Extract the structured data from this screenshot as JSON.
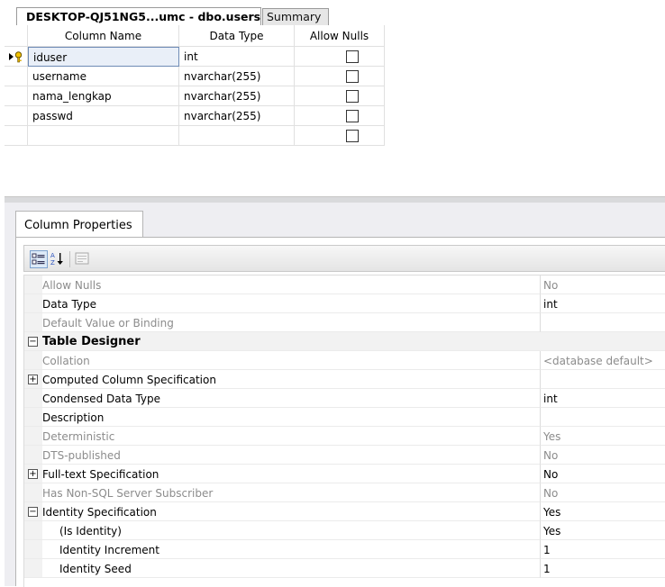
{
  "tabs": {
    "active_label": "DESKTOP-QJ51NG5...umc - dbo.users",
    "inactive_label": "Summary"
  },
  "grid": {
    "headers": [
      "Column Name",
      "Data Type",
      "Allow Nulls"
    ],
    "rows": [
      {
        "name": "iduser",
        "type": "int",
        "allow_nulls": false
      },
      {
        "name": "username",
        "type": "nvarchar(255)",
        "allow_nulls": false
      },
      {
        "name": "nama_lengkap",
        "type": "nvarchar(255)",
        "allow_nulls": false
      },
      {
        "name": "passwd",
        "type": "nvarchar(255)",
        "allow_nulls": false
      },
      {
        "name": "",
        "type": "",
        "allow_nulls": false
      }
    ]
  },
  "properties": {
    "tab_label": "Column Properties",
    "toolbar": {
      "categorized_icon": "categorized-icon",
      "alphabetical_icon": "alphabetical-sort-icon",
      "property_pages_icon": "property-pages-icon"
    },
    "rows": [
      {
        "name": "Allow Nulls",
        "value": "No"
      },
      {
        "name": "Data Type",
        "value": "int"
      },
      {
        "name": "Default Value or Binding",
        "value": ""
      },
      {
        "name": "Table Designer",
        "value": ""
      },
      {
        "name": "Collation",
        "value": "<database default>"
      },
      {
        "name": "Computed Column Specification",
        "value": ""
      },
      {
        "name": "Condensed Data Type",
        "value": "int"
      },
      {
        "name": "Description",
        "value": ""
      },
      {
        "name": "Deterministic",
        "value": "Yes"
      },
      {
        "name": "DTS-published",
        "value": "No"
      },
      {
        "name": "Full-text Specification",
        "value": "No"
      },
      {
        "name": "Has Non-SQL Server Subscriber",
        "value": "No"
      },
      {
        "name": "Identity Specification",
        "value": "Yes"
      },
      {
        "name": "(Is Identity)",
        "value": "Yes"
      },
      {
        "name": "Identity Increment",
        "value": "1"
      },
      {
        "name": "Identity Seed",
        "value": "1"
      }
    ]
  }
}
